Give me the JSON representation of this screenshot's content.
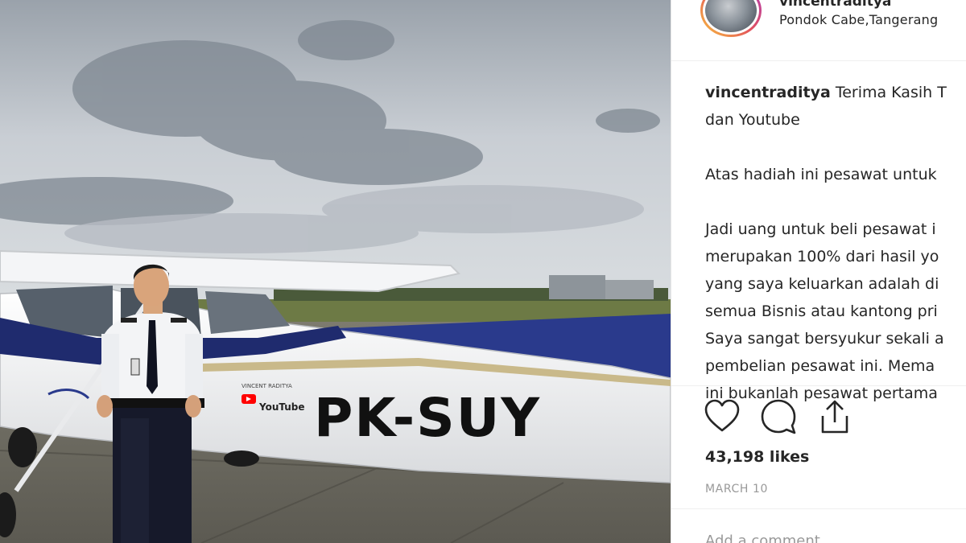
{
  "post": {
    "username": "vincentraditya",
    "location": "Pondok Cabe,Tangerang",
    "caption": [
      "Terima Kasih T",
      "dan Youtube",
      "Atas hadiah ini pesawat untuk",
      "Jadi uang untuk beli pesawat i",
      "merupakan 100% dari hasil yo",
      "yang saya keluarkan adalah di",
      "semua Bisnis atau kantong pri",
      "Saya sangat bersyukur sekali a",
      "pembelian pesawat ini. Mema",
      "ini bukanlah pesawat pertama"
    ],
    "likes": "43,198 likes",
    "date": "MARCH 10",
    "comment_placeholder": "Add a comment..."
  },
  "photo": {
    "registration": "PK-SUY",
    "badge_text": "YouTube",
    "sticker_text": "VINCENT RADITYA"
  },
  "icons": {
    "like": "heart-icon",
    "comment": "comment-icon",
    "share": "share-icon"
  },
  "colors": {
    "text": "#262626",
    "muted": "#999999",
    "avatar_ring": "#e2525c",
    "plane_stripe": "#1f2b6e",
    "youtube_red": "#ff0000"
  }
}
